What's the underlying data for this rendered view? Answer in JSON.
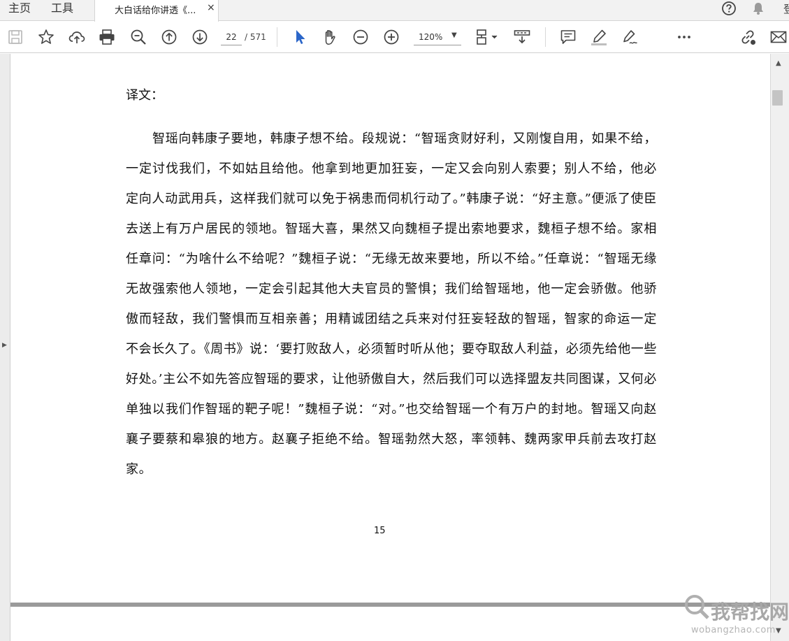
{
  "tabs": {
    "home": "主页",
    "tools": "工具",
    "document": "大白话给你讲透《...",
    "close": "×"
  },
  "header_right": {
    "login_partial": "登"
  },
  "toolbar": {
    "page_current": "22",
    "page_total": "/ 571",
    "zoom": "120%"
  },
  "icons": [
    "save-icon",
    "star-icon",
    "cloud-upload-icon",
    "print-icon",
    "zoom-out-search-icon",
    "page-up-icon",
    "page-down-icon",
    "select-cursor-icon",
    "hand-icon",
    "zoom-minus-icon",
    "zoom-plus-icon",
    "fit-page-icon",
    "scroll-mode-icon",
    "comment-icon",
    "highlight-icon",
    "sign-icon",
    "more-icon",
    "share-link-icon",
    "email-icon"
  ],
  "colors": {
    "accent": "#2b66c9",
    "icon": "#444444"
  },
  "document": {
    "heading": "译文：",
    "paragraph": "智瑶向韩康子要地，韩康子想不给。段规说：“智瑶贪财好利，又刚愎自用，如果不给，一定讨伐我们，不如姑且给他。他拿到地更加狂妄，一定又会向别人索要；别人不给，他必定向人动武用兵，这样我们就可以免于祸患而伺机行动了。”韩康子说：“好主意。”便派了使臣去送上有万户居民的领地。智瑶大喜，果然又向魏桓子提出索地要求，魏桓子想不给。家相任章问：“为啥什么不给呢？”魏桓子说：“无缘无故来要地，所以不给。”任章说：“智瑶无缘无故强索他人领地，一定会引起其他大夫官员的警惧；我们给智瑶地，他一定会骄傲。他骄傲而轻敌，我们警惧而互相亲善；用精诚团结之兵来对付狂妄轻敌的智瑶，智家的命运一定不会长久了。《周书》说：‘要打败敌人，必须暂时听从他；要夺取敌人利益，必须先给他一些好处。’主公不如先答应智瑶的要求，让他骄傲自大，然后我们可以选择盟友共同图谋，又何必单独以我们作智瑶的靶子呢！”魏桓子说：“对。”也交给智瑶一个有万户的封地。智瑶又向赵襄子要蔡和皋狼的地方。赵襄子拒绝不给。智瑶勃然大怒，率领韩、魏两家甲兵前去攻打赵家。",
    "page_number": "15"
  },
  "watermark": {
    "main": "我帮找网",
    "sub": "wobangzhao.com"
  }
}
